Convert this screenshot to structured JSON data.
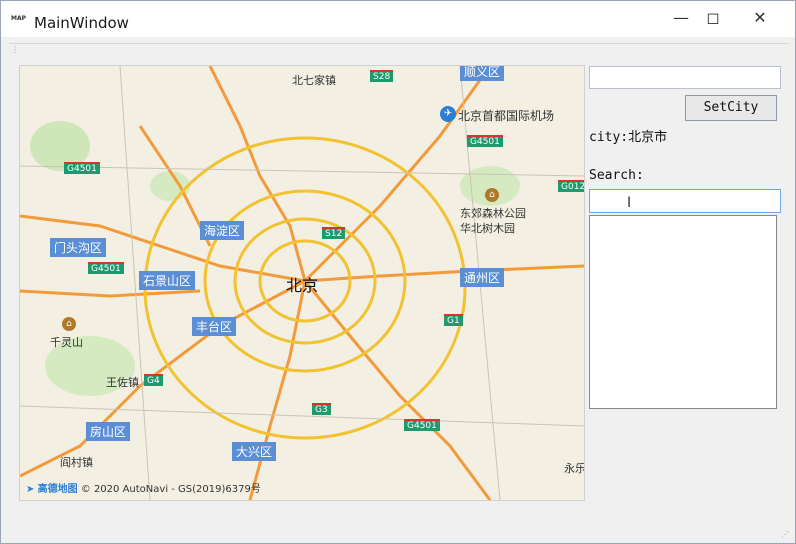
{
  "window": {
    "title": "MainWindow",
    "app_icon_text": "MAP",
    "controls": {
      "minimize": "—",
      "maximize": "◻",
      "close": "✕"
    }
  },
  "map": {
    "city_center_label": "北京",
    "district_labels": [
      "门头沟区",
      "石景山区",
      "海淀区",
      "丰台区",
      "通州区",
      "房山区",
      "大兴区",
      "顺义区"
    ],
    "road_shields": [
      "S28",
      "G4501",
      "G4501",
      "G4501",
      "S12",
      "G1",
      "G4",
      "G3",
      "G4501",
      "G012"
    ],
    "place_labels": [
      "北七家镇",
      "北京首都国际机场",
      "东郊森林公园华北树木园",
      "千灵山",
      "王佐镇",
      "阎村镇",
      "永乐"
    ],
    "poi_names": [
      "东郊森林公园华北树木园",
      "千灵山"
    ],
    "airport": "北京首都国际机场",
    "copyright": "© 2020 AutoNavi - GS(2019)6379号",
    "logo_text": "高德地图"
  },
  "panel": {
    "top_input_value": "",
    "setcity_label": "SetCity",
    "city_text": "city:北京市",
    "search_label": "Search:",
    "search_value": "",
    "results": []
  },
  "colors": {
    "district_label": "#5a8fd6",
    "road_shield": "#1f9a6e",
    "ring_road": "#f2c230",
    "highway": "#f39a3a",
    "map_bg": "#f3efe3"
  }
}
